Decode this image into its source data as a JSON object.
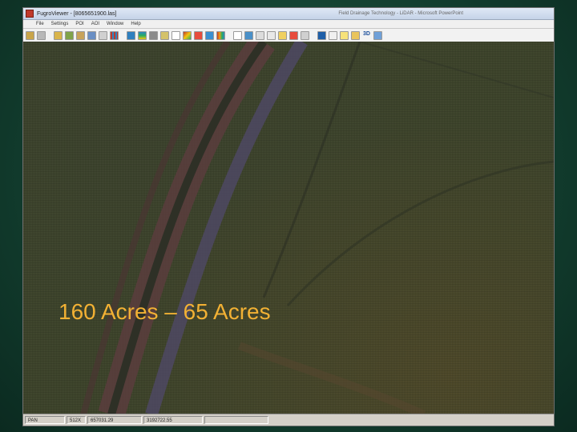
{
  "window": {
    "title": "FugroViewer - [8065651900.las]",
    "title_right": "Field Drainage Technology - LiDAR - Microsoft PowerPoint"
  },
  "menu": [
    "File",
    "Settings",
    "POI",
    "AOI",
    "Window",
    "Help"
  ],
  "toolbar": {
    "three_d_label": "3D"
  },
  "overlay": {
    "caption": "160 Acres – 65 Acres"
  },
  "status": {
    "mode": "PAN",
    "zoom": "512X",
    "easting": "657031.29",
    "northing": "3192722.55"
  },
  "colors": {
    "caption": "#f2b134",
    "background_frame": "#154434",
    "terrain": "#3a4128"
  }
}
